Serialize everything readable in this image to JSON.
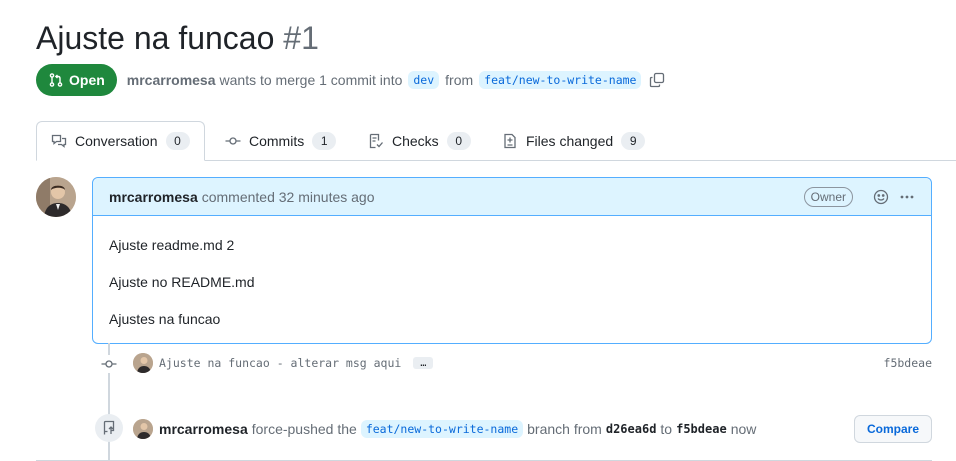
{
  "pr": {
    "title": "Ajuste na funcao",
    "number": "#1",
    "state": "Open",
    "author": "mrcarromesa",
    "summary_text": "wants to merge 1 commit into",
    "base_branch": "dev",
    "from_text": "from",
    "head_branch": "feat/new-to-write-name"
  },
  "tabs": [
    {
      "label": "Conversation",
      "count": "0",
      "icon": "comment-discussion-icon"
    },
    {
      "label": "Commits",
      "count": "1",
      "icon": "git-commit-icon"
    },
    {
      "label": "Checks",
      "count": "0",
      "icon": "checklist-icon"
    },
    {
      "label": "Files changed",
      "count": "9",
      "icon": "file-diff-icon"
    }
  ],
  "comment": {
    "author": "mrcarromesa",
    "action": "commented 32 minutes ago",
    "badge": "Owner",
    "body": [
      "Ajuste readme.md 2",
      "Ajuste no README.md",
      "Ajustes na funcao"
    ]
  },
  "commit": {
    "message": "Ajuste na funcao - alterar msg aqui",
    "ellipsis": "…",
    "sha": "f5bdeae"
  },
  "force_push": {
    "author": "mrcarromesa",
    "text1": "force-pushed the",
    "branch": "feat/new-to-write-name",
    "text2": "branch from",
    "from_sha": "d26ea6d",
    "text3": "to",
    "to_sha": "f5bdeae",
    "text4": "now",
    "compare_label": "Compare"
  },
  "colors": {
    "open_green": "#1f883d",
    "link_blue": "#0969da",
    "comment_header_bg": "#ddf4ff"
  }
}
